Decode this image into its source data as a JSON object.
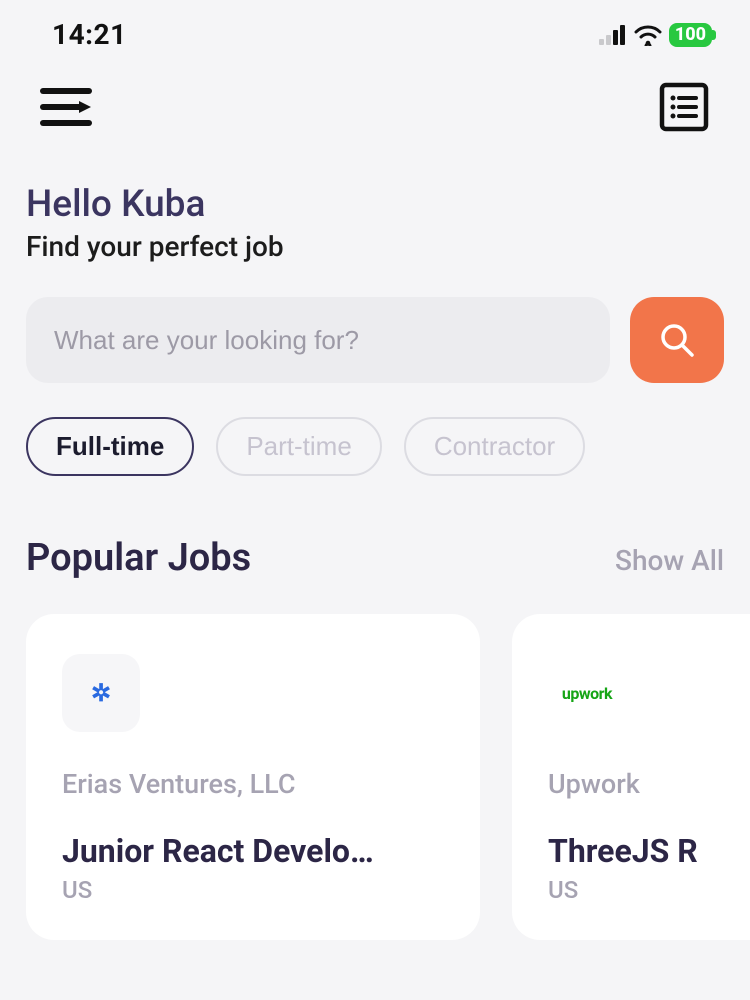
{
  "status": {
    "time": "14:21",
    "battery": "100"
  },
  "greeting": {
    "hello": "Hello Kuba",
    "sub": "Find your perfect job"
  },
  "search": {
    "placeholder": "What are your looking for?"
  },
  "filters": {
    "items": [
      {
        "label": "Full-time"
      },
      {
        "label": "Part-time"
      },
      {
        "label": "Contractor"
      }
    ]
  },
  "popular": {
    "title": "Popular Jobs",
    "show_all": "Show All",
    "cards": [
      {
        "company": "Erias Ventures, LLC",
        "title": "Junior React Develo…",
        "location": "US"
      },
      {
        "company": "Upwork",
        "title": "ThreeJS R",
        "location": "US"
      }
    ]
  },
  "logos": {
    "erias": "✲",
    "upwork": "upwork"
  }
}
